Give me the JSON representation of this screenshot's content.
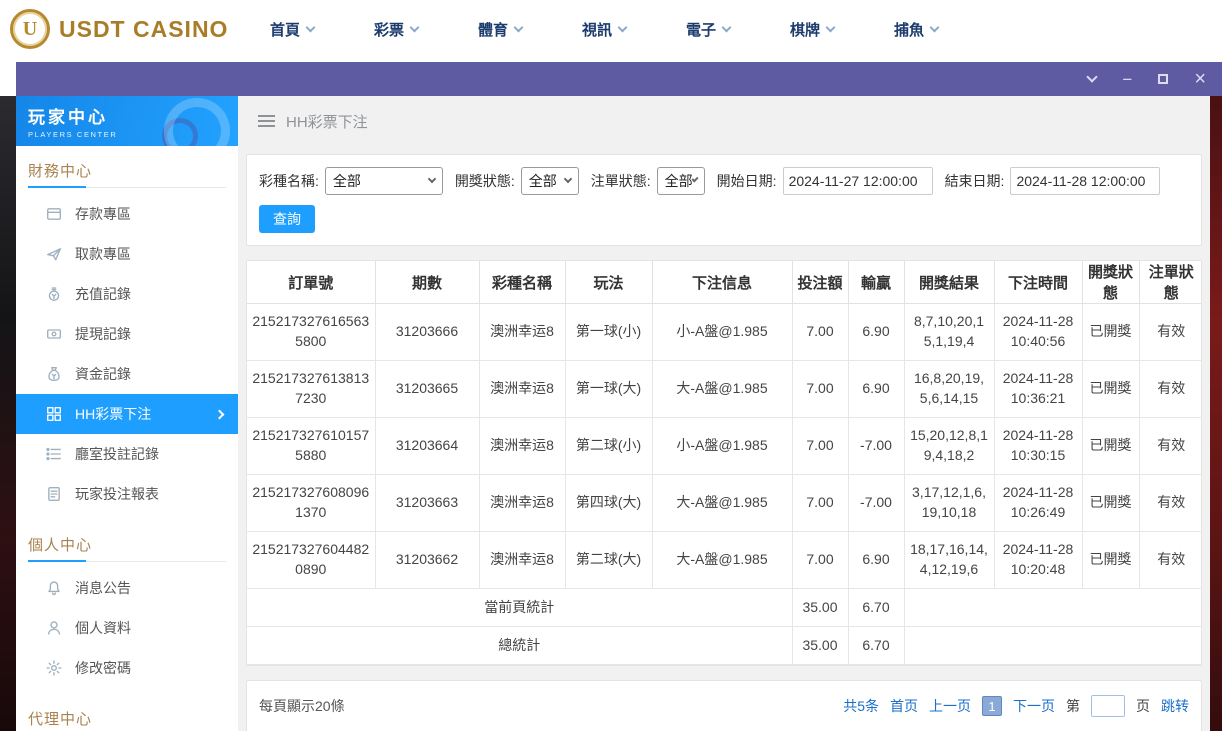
{
  "topnav": {
    "logo_text": "USDT CASINO",
    "logo_letter": "U",
    "items": [
      "首頁",
      "彩票",
      "體育",
      "視訊",
      "電子",
      "棋牌",
      "捕魚"
    ]
  },
  "sidebar": {
    "title": "玩家中心",
    "subtitle": "PLAYERS CENTER",
    "sections": [
      {
        "title": "財務中心",
        "items": [
          {
            "label": "存款專區",
            "icon": "deposit-icon"
          },
          {
            "label": "取款專區",
            "icon": "withdraw-icon"
          },
          {
            "label": "充值記錄",
            "icon": "recharge-icon"
          },
          {
            "label": "提現記錄",
            "icon": "cashout-icon"
          },
          {
            "label": "資金記錄",
            "icon": "funds-icon"
          },
          {
            "label": "HH彩票下注",
            "icon": "lottery-icon",
            "active": true
          },
          {
            "label": "廳室投註記錄",
            "icon": "hall-record-icon"
          },
          {
            "label": "玩家投注報表",
            "icon": "report-icon"
          }
        ]
      },
      {
        "title": "個人中心",
        "items": [
          {
            "label": "消息公告",
            "icon": "bell-icon"
          },
          {
            "label": "個人資料",
            "icon": "user-icon"
          },
          {
            "label": "修改密碼",
            "icon": "gear-icon"
          }
        ]
      },
      {
        "title": "代理中心",
        "items": []
      }
    ]
  },
  "main": {
    "page_title": "HH彩票下注",
    "filters": {
      "lottery_label": "彩種名稱:",
      "lottery_value": "全部",
      "draw_status_label": "開獎狀態:",
      "draw_status_value": "全部",
      "order_status_label": "注單狀態:",
      "order_status_value": "全部",
      "start_label": "開始日期:",
      "start_value": "2024-11-27 12:00:00",
      "end_label": "結束日期:",
      "end_value": "2024-11-28 12:00:00",
      "search_label": "查詢"
    },
    "table": {
      "headers": [
        "訂單號",
        "期數",
        "彩種名稱",
        "玩法",
        "下注信息",
        "投注額",
        "輸贏",
        "開獎結果",
        "下注時間",
        "開獎狀態",
        "注單狀態"
      ],
      "rows": [
        [
          "2152173276165635800",
          "31203666",
          "澳洲幸运8",
          "第一球(小)",
          "小-A盤@1.985",
          "7.00",
          "6.90",
          "8,7,10,20,15,1,19,4",
          "2024-11-28 10:40:56",
          "已開獎",
          "有效"
        ],
        [
          "2152173276138137230",
          "31203665",
          "澳洲幸运8",
          "第一球(大)",
          "大-A盤@1.985",
          "7.00",
          "6.90",
          "16,8,20,19,5,6,14,15",
          "2024-11-28 10:36:21",
          "已開獎",
          "有效"
        ],
        [
          "2152173276101575880",
          "31203664",
          "澳洲幸运8",
          "第二球(小)",
          "小-A盤@1.985",
          "7.00",
          "-7.00",
          "15,20,12,8,19,4,18,2",
          "2024-11-28 10:30:15",
          "已開獎",
          "有效"
        ],
        [
          "2152173276080961370",
          "31203663",
          "澳洲幸运8",
          "第四球(大)",
          "大-A盤@1.985",
          "7.00",
          "-7.00",
          "3,17,12,1,6,19,10,18",
          "2024-11-28 10:26:49",
          "已開獎",
          "有效"
        ],
        [
          "2152173276044820890",
          "31203662",
          "澳洲幸运8",
          "第二球(大)",
          "大-A盤@1.985",
          "7.00",
          "6.90",
          "18,17,16,14,4,12,19,6",
          "2024-11-28 10:20:48",
          "已開獎",
          "有效"
        ]
      ],
      "summary_rows": [
        {
          "label": "當前頁統計",
          "bet": "35.00",
          "win": "6.70"
        },
        {
          "label": "總統計",
          "bet": "35.00",
          "win": "6.70"
        }
      ]
    },
    "pagination": {
      "per_page": "每頁顯示20條",
      "total": "共5条",
      "first": "首页",
      "prev": "上一页",
      "current": "1",
      "next": "下一页",
      "jump_prefix": "第",
      "jump_suffix": "页",
      "jump": "跳转"
    }
  },
  "colors": {
    "accent_blue": "#1e9fff",
    "titlebar_purple": "#5e5ba2",
    "nav_navy": "#1d3c6e",
    "section_brown": "#a8824f",
    "link_blue": "#1a6fc9",
    "logo_gold": "#a97c28"
  }
}
